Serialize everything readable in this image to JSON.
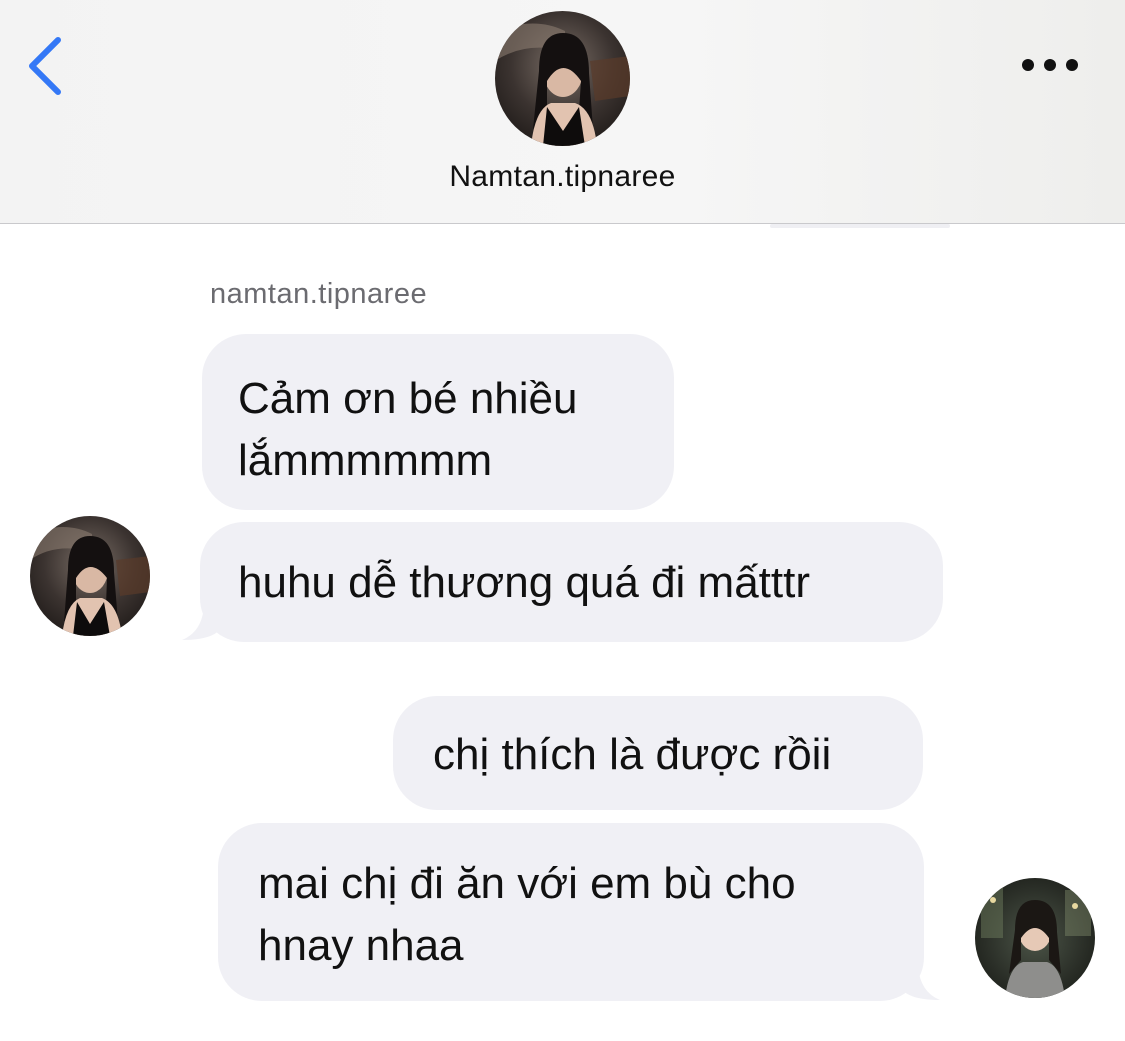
{
  "header": {
    "contact_name": "Namtan.tipnaree",
    "back_icon": "chevron-left-icon",
    "more_icon": "ellipsis-icon",
    "accent_color": "#3478f6"
  },
  "thread": {
    "sender_label": "namtan.tipnaree",
    "messages": [
      {
        "from": "them",
        "lines": [
          "Cảm ơn bé nhiều",
          "lắmmmmmm"
        ]
      },
      {
        "from": "them",
        "lines": [
          "huhu dễ thương quá đi mấtttr"
        ]
      },
      {
        "from": "me",
        "lines": [
          "chị thích là được rồii"
        ]
      },
      {
        "from": "me",
        "lines": [
          "mai chị đi ăn với em bù cho",
          "hnay nhaa"
        ]
      }
    ]
  },
  "colors": {
    "bubble": "#f0f0f5",
    "text": "#111111",
    "sender_label": "#6b6b70"
  }
}
